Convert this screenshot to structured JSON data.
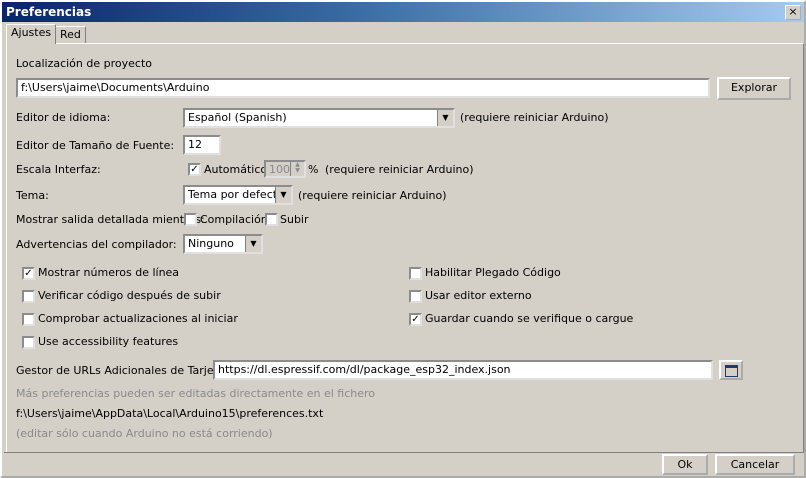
{
  "window": {
    "title": "Preferencias",
    "close_label": "×"
  },
  "tabs": [
    {
      "label": "Ajustes"
    },
    {
      "label": "Red"
    }
  ],
  "sketchbook": {
    "label": "Localización de proyecto",
    "value": "f:\\Users\\jaime\\Documents\\Arduino",
    "browse_label": "Explorar"
  },
  "language": {
    "label": "Editor de idioma:",
    "value": "Español (Spanish)",
    "note": "(requiere reiniciar Arduino)"
  },
  "font_size": {
    "label": "Editor de Tamaño de Fuente:",
    "value": "12"
  },
  "scale": {
    "label": "Escala Interfaz:",
    "auto_label": "Automático",
    "value": "100",
    "percent": "%",
    "note": "(requiere reiniciar Arduino)"
  },
  "theme": {
    "label": "Tema:",
    "value": "Tema por defecto",
    "note": "(requiere reiniciar Arduino)"
  },
  "verbose": {
    "label": "Mostrar salida detallada mientras:",
    "compile_label": "Compilación",
    "upload_label": "Subir"
  },
  "warnings": {
    "label": "Advertencias del compilador:",
    "value": "Ninguno"
  },
  "options_left": [
    {
      "label": "Mostrar números de línea",
      "checked": true
    },
    {
      "label": "Verificar código después de subir",
      "checked": false
    },
    {
      "label": "Comprobar actualizaciones al iniciar",
      "checked": false
    },
    {
      "label": "Use accessibility features",
      "checked": false
    }
  ],
  "options_right": [
    {
      "label": "Habilitar Plegado Código",
      "checked": false
    },
    {
      "label": "Usar editor externo",
      "checked": false
    },
    {
      "label": "Guardar cuando se verifique o cargue",
      "checked": true
    }
  ],
  "boards_url": {
    "label": "Gestor de URLs Adicionales de Tarjetas:",
    "value": "https://dl.espressif.com/dl/package_esp32_index.json"
  },
  "info": {
    "line1": "Más preferencias pueden ser editadas directamente en el fichero",
    "path": "f:\\Users\\jaime\\AppData\\Local\\Arduino15\\preferences.txt",
    "line3": "(editar sólo cuando Arduino no está corriendo)"
  },
  "footer": {
    "ok_label": "Ok",
    "cancel_label": "Cancelar"
  }
}
